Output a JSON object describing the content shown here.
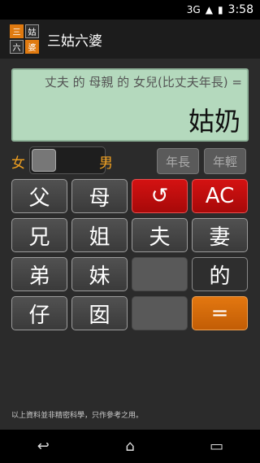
{
  "status": {
    "time": "3:58",
    "network": "3G"
  },
  "app": {
    "title": "三姑六婆",
    "logo": [
      "三",
      "姑",
      "六",
      "婆"
    ]
  },
  "display": {
    "expression": "丈夫 的 母親 的 女兒(比丈夫年長) =",
    "result": "姑奶"
  },
  "controls": {
    "female_label": "女",
    "male_label": "男",
    "older_label": "年長",
    "younger_label": "年輕"
  },
  "keypad": {
    "father": "父",
    "mother": "母",
    "undo": "↺",
    "clear": "AC",
    "brother": "兄",
    "sister": "姐",
    "husband": "夫",
    "wife": "妻",
    "younger_brother": "弟",
    "younger_sister": "妹",
    "of": "的",
    "son": "仔",
    "daughter": "囡",
    "equals": "="
  },
  "disclaimer": "以上資料並非精密科學，只作參考之用。",
  "colors": {
    "accent": "#e07a10",
    "display_bg": "#b4d9bd",
    "undo_red": "#c81010"
  }
}
